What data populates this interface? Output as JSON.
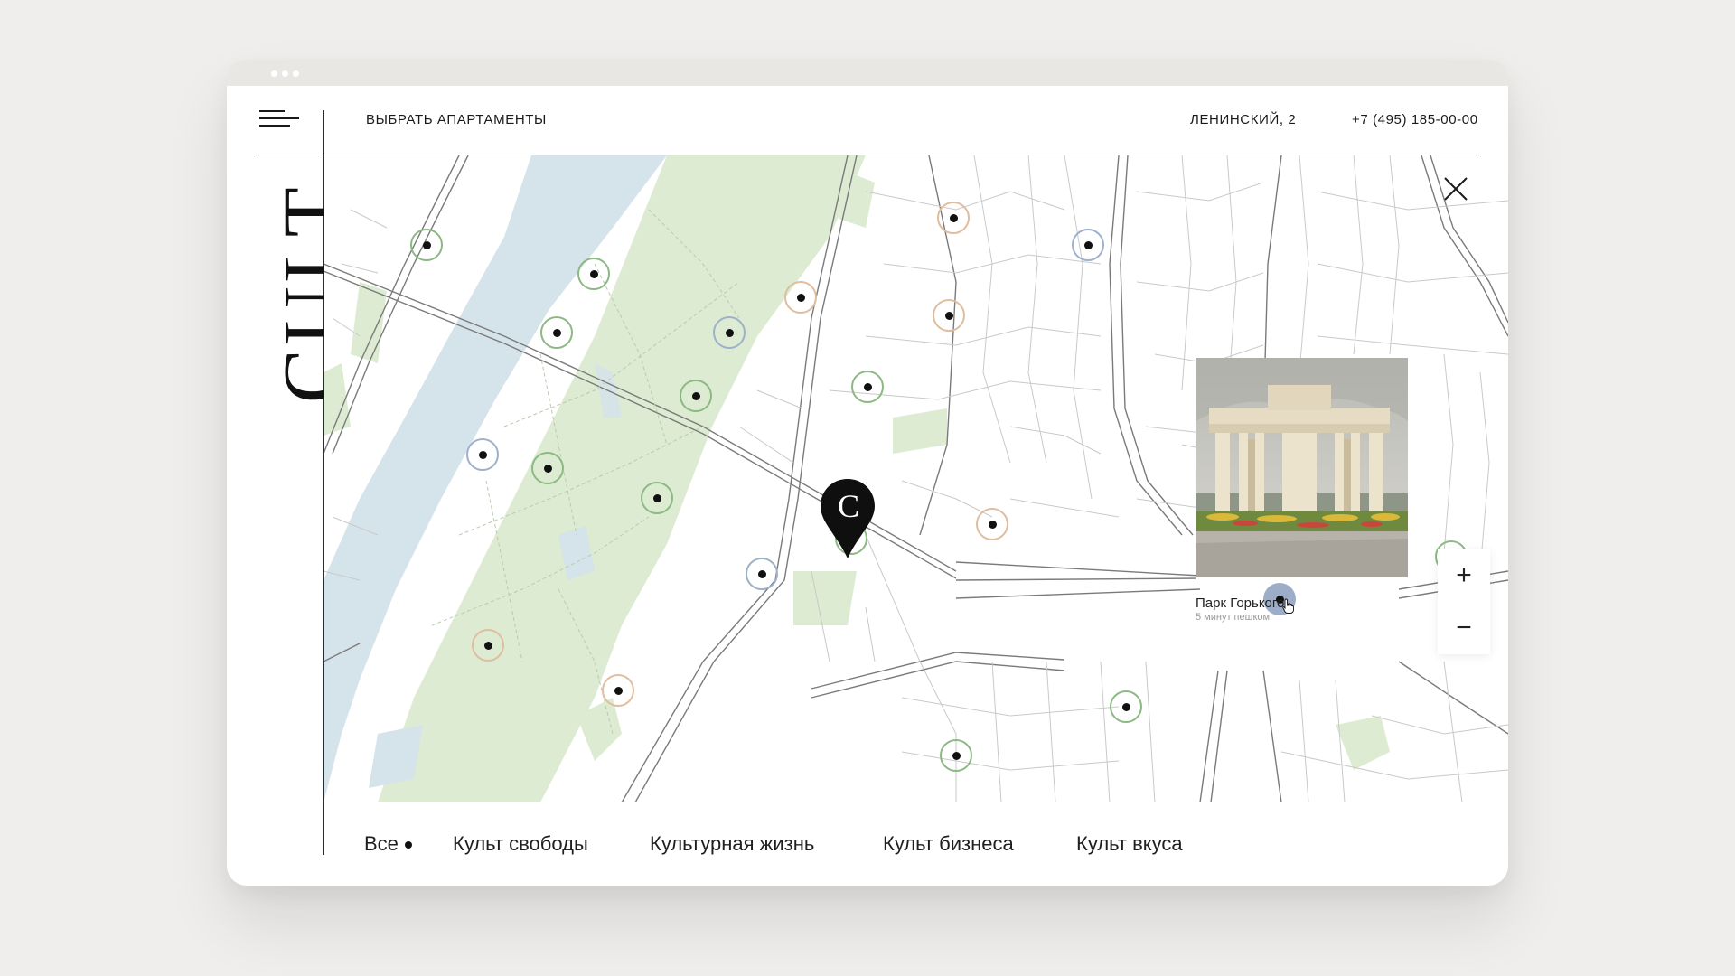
{
  "header": {
    "choose_label": "ВЫБРАТЬ АПАРТАМЕНТЫ",
    "address": "ЛЕНИНСКИЙ, 2",
    "phone": "+7 (495) 185-00-00"
  },
  "logo": {
    "text": "CULT"
  },
  "pin": {
    "letter": "C"
  },
  "popup": {
    "title": "Парк Горького",
    "subtitle": "5 минут пешком"
  },
  "zoom": {
    "in": "+",
    "out": "−"
  },
  "filters": [
    {
      "label": "Все",
      "active": true
    },
    {
      "label": "Культ свободы"
    },
    {
      "label": "Культурная жизнь"
    },
    {
      "label": "Культ бизнеса"
    },
    {
      "label": "Культ вкуса"
    }
  ],
  "colors": {
    "park": "#dcebd2",
    "river": "#d5e3ea",
    "marker_green": "#8cb983",
    "marker_blue": "#9eb0ca",
    "marker_tan": "#dfbd9d",
    "marker_active": "#9eadc7"
  }
}
